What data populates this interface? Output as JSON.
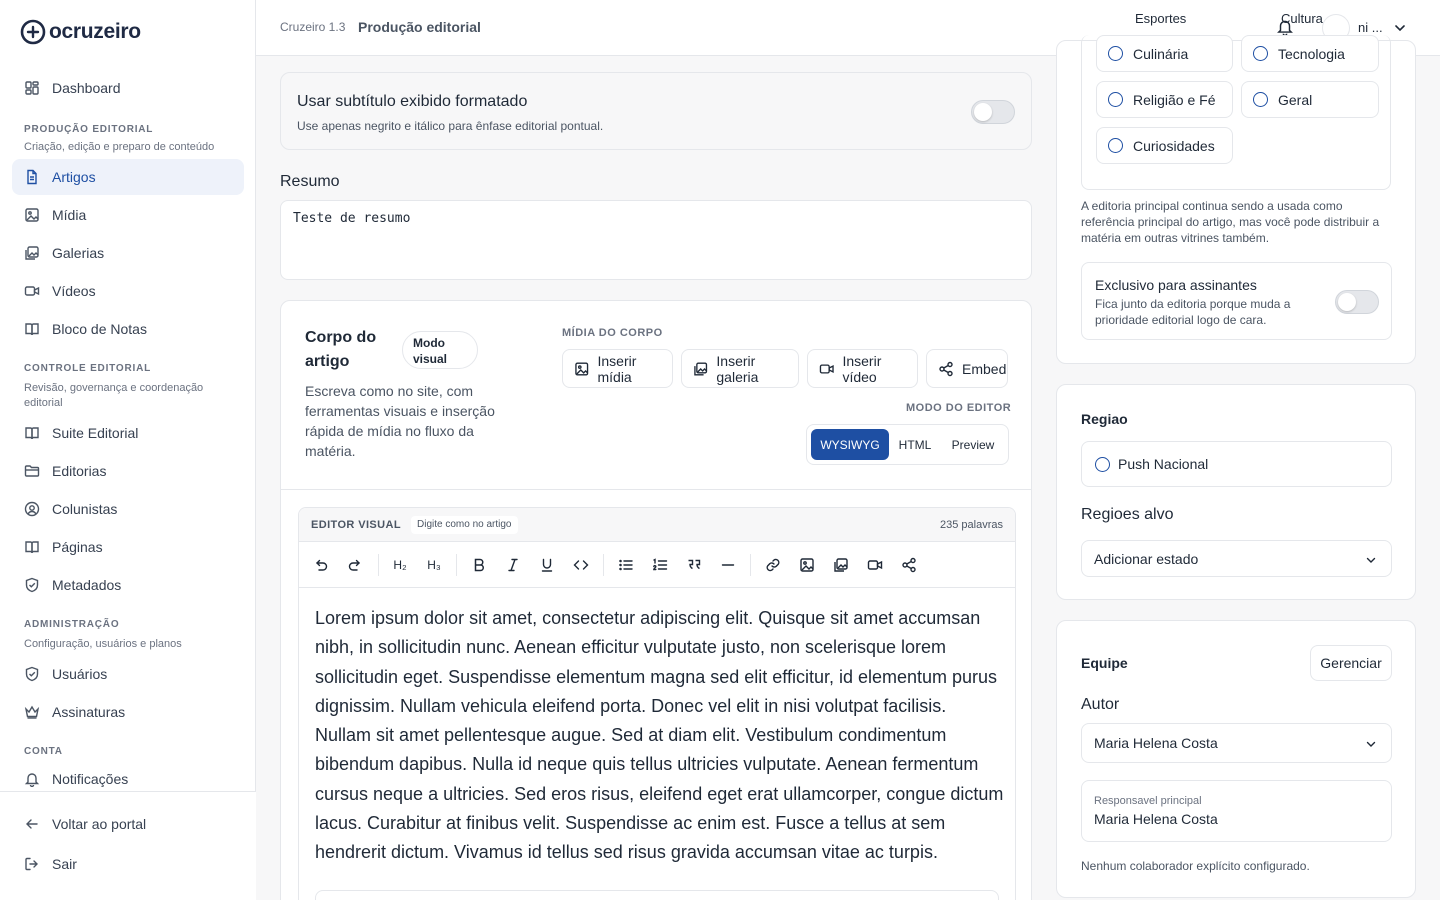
{
  "brand": {
    "logo_text": "ocruzeiro",
    "accent_color": "#1e4fa3"
  },
  "sidebar": {
    "top_items": [
      {
        "label": "Dashboard",
        "icon": "dashboard-icon"
      }
    ],
    "sections": [
      {
        "title": "PRODUÇÃO EDITORIAL",
        "subtitle": "Criação, edição e preparo de conteúdo",
        "items": [
          {
            "label": "Artigos",
            "icon": "document-icon",
            "active": true
          },
          {
            "label": "Mídia",
            "icon": "image-icon"
          },
          {
            "label": "Galerias",
            "icon": "gallery-icon"
          },
          {
            "label": "Vídeos",
            "icon": "video-icon"
          },
          {
            "label": "Bloco de Notas",
            "icon": "book-icon"
          }
        ]
      },
      {
        "title": "CONTROLE EDITORIAL",
        "subtitle": "Revisão, governança e coordenação editorial",
        "items": [
          {
            "label": "Suite Editorial",
            "icon": "book-icon"
          },
          {
            "label": "Editorias",
            "icon": "folder-icon"
          },
          {
            "label": "Colunistas",
            "icon": "user-circle-icon"
          },
          {
            "label": "Páginas",
            "icon": "book-icon"
          },
          {
            "label": "Metadados",
            "icon": "shield-icon"
          }
        ]
      },
      {
        "title": "ADMINISTRAÇÃO",
        "subtitle": "Configuração, usuários e planos",
        "items": [
          {
            "label": "Usuários",
            "icon": "shield-icon"
          },
          {
            "label": "Assinaturas",
            "icon": "crown-icon"
          }
        ]
      },
      {
        "title": "CONTA",
        "subtitle": "",
        "items": [
          {
            "label": "Notificações",
            "icon": "bell-icon"
          }
        ]
      }
    ],
    "footer": {
      "back_label": "Voltar ao portal",
      "logout_label": "Sair"
    }
  },
  "topbar": {
    "version": "Cruzeiro 1.3",
    "page_title": "Produção editorial",
    "categories": [
      "Esportes",
      "Cultura"
    ],
    "user_name": "ni ..."
  },
  "subtitle_card": {
    "title": "Usar subtítulo exibido formatado",
    "description": "Use apenas negrito e itálico para ênfase editorial pontual.",
    "enabled": false
  },
  "resumo": {
    "label": "Resumo",
    "value": "Teste de resumo"
  },
  "body_card": {
    "title": "Corpo do artigo",
    "badge": "Modo visual",
    "description": "Escreva como no site, com ferramentas visuais e inserção rápida de mídia no fluxo da matéria.",
    "media_label": "MÍDIA DO CORPO",
    "media_buttons": [
      "Inserir mídia",
      "Inserir galeria",
      "Inserir vídeo",
      "Embed"
    ],
    "mode_label": "MODO DO EDITOR",
    "modes": [
      "WYSIWYG",
      "HTML",
      "Preview"
    ],
    "active_mode": "WYSIWYG"
  },
  "editor": {
    "label": "EDITOR VISUAL",
    "chip": "Digite como no artigo",
    "word_count": "235 palavras",
    "toolbar": [
      "undo-icon",
      "redo-icon",
      "H2",
      "H3",
      "bold-icon",
      "italic-icon",
      "underline-icon",
      "code-icon",
      "bullet-list-icon",
      "numbered-list-icon",
      "quote-icon",
      "horizontal-rule-icon",
      "link-icon",
      "image-icon",
      "gallery-icon",
      "video-icon",
      "share-icon"
    ],
    "heading2": "H₂",
    "heading3": "H₃",
    "content": "Lorem ipsum dolor sit amet, consectetur adipiscing elit. Quisque sit amet accumsan nibh, in sollicitudin nunc. Aenean efficitur vulputate justo, non scelerisque lorem sollicitudin eget. Suspendisse elementum magna sed elit efficitur, id elementum purus dignissim. Nullam vehicula eleifend porta. Donec vel elit in nisi volutpat facilisis. Nullam sit amet pellentesque augue. Sed at diam elit. Vestibulum condimentum bibendum dapibus. Nulla id neque quis tellus ultricies vulputate. Aenean fermentum cursus neque a ultricies. Sed eros risus, eleifend eget erat ullamcorper, congue dictum lacus. Curabitur at finibus velit. Suspendisse ac enim est. Fusce a tellus at sem hendrerit dictum. Vivamus id tellus sed risus gravida accumsan vitae ac turpis."
  },
  "categories_panel": {
    "options": [
      "Culinária",
      "Tecnologia",
      "Religião e Fé",
      "Geral",
      "Curiosidades"
    ],
    "help": "A editoria principal continua sendo a usada como referência principal do artigo, mas você pode distribuir a matéria em outras vitrines também.",
    "exclusive": {
      "title": "Exclusivo para assinantes",
      "description": "Fica junto da editoria porque muda a prioridade editorial logo de cara.",
      "enabled": false
    }
  },
  "regiao": {
    "title": "Regiao",
    "option": "Push Nacional",
    "targets_label": "Regioes alvo",
    "targets_placeholder": "Adicionar estado"
  },
  "equipe": {
    "title": "Equipe",
    "manage_label": "Gerenciar",
    "author_label": "Autor",
    "author_value": "Maria Helena Costa",
    "responsible_label": "Responsavel principal",
    "responsible_value": "Maria Helena Costa",
    "help": "Nenhum colaborador explícito configurado."
  }
}
